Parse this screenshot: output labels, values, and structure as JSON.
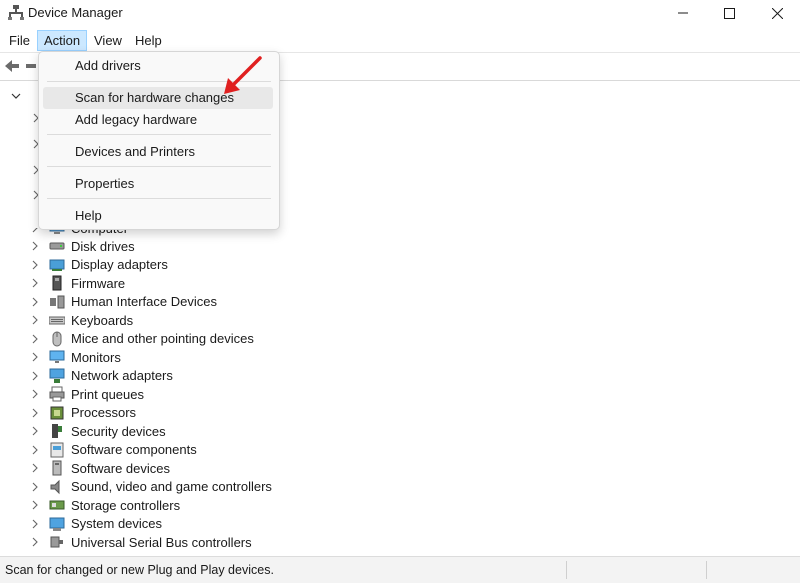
{
  "window": {
    "title": "Device Manager"
  },
  "menubar": {
    "file": "File",
    "action": "Action",
    "view": "View",
    "help": "Help"
  },
  "dropdown": {
    "items": [
      "Add drivers",
      "Scan for hardware changes",
      "Add legacy hardware",
      "Devices and Printers",
      "Properties",
      "Help"
    ],
    "highlighted": "Scan for hardware changes"
  },
  "tree": {
    "partial_label": "Computer",
    "categories": [
      {
        "label": "Disk drives",
        "icon": "disk-drive-icon"
      },
      {
        "label": "Display adapters",
        "icon": "display-adapter-icon"
      },
      {
        "label": "Firmware",
        "icon": "firmware-icon"
      },
      {
        "label": "Human Interface Devices",
        "icon": "hid-icon"
      },
      {
        "label": "Keyboards",
        "icon": "keyboard-icon"
      },
      {
        "label": "Mice and other pointing devices",
        "icon": "mouse-icon"
      },
      {
        "label": "Monitors",
        "icon": "monitor-icon"
      },
      {
        "label": "Network adapters",
        "icon": "network-adapter-icon"
      },
      {
        "label": "Print queues",
        "icon": "printer-icon"
      },
      {
        "label": "Processors",
        "icon": "processor-icon"
      },
      {
        "label": "Security devices",
        "icon": "security-device-icon"
      },
      {
        "label": "Software components",
        "icon": "software-component-icon"
      },
      {
        "label": "Software devices",
        "icon": "software-device-icon"
      },
      {
        "label": "Sound, video and game controllers",
        "icon": "sound-icon"
      },
      {
        "label": "Storage controllers",
        "icon": "storage-controller-icon"
      },
      {
        "label": "System devices",
        "icon": "system-devices-icon"
      },
      {
        "label": "Universal Serial Bus controllers",
        "icon": "usb-icon"
      }
    ]
  },
  "statusbar": {
    "text": "Scan for changed or new Plug and Play devices."
  },
  "colors": {
    "menu_active_bg": "#cce8ff",
    "annotation_arrow": "#e02020",
    "dropdown_bg": "#f9f9f9"
  }
}
